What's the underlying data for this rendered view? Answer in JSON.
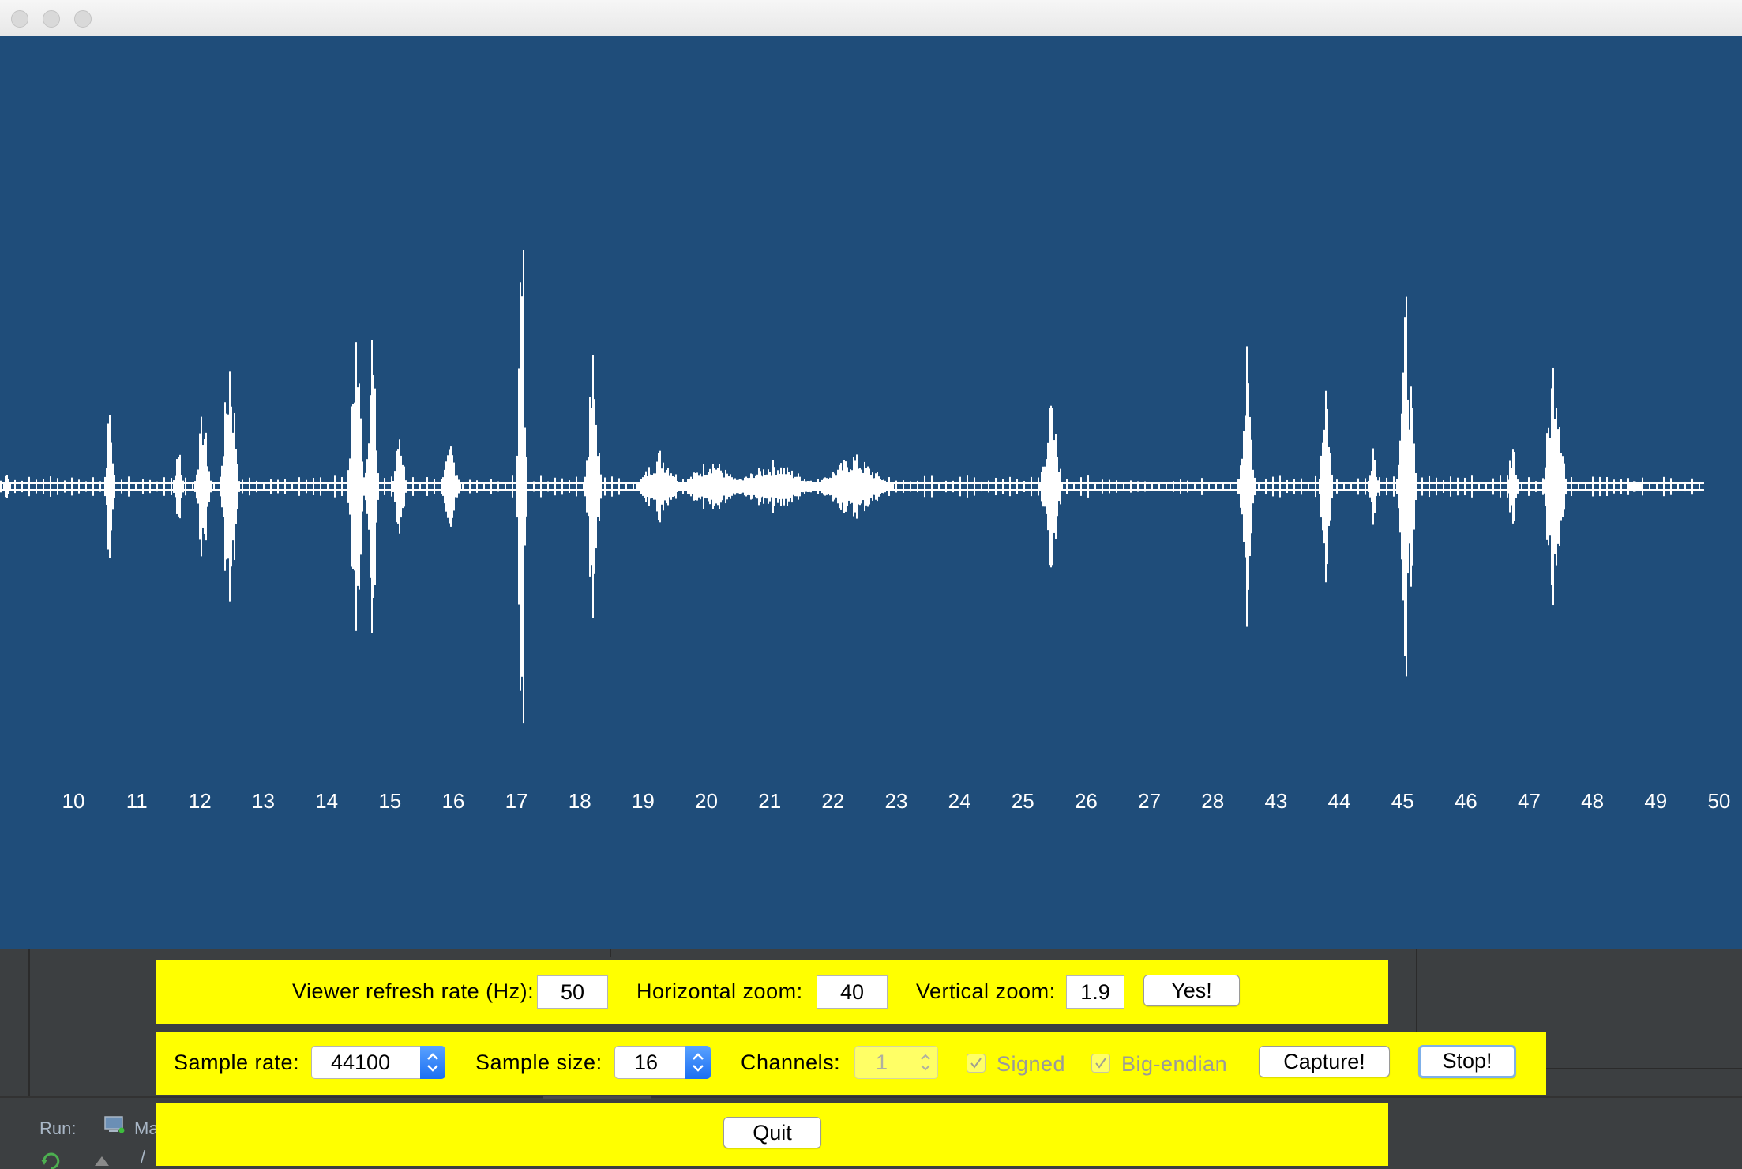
{
  "window": {
    "buttons": [
      "close-button",
      "minimize-button",
      "zoom-button"
    ]
  },
  "viewer": {
    "background": "#1f4d7a",
    "waveform_color": "#ffffff",
    "time_labels": [
      "10",
      "11",
      "12",
      "13",
      "14",
      "15",
      "16",
      "17",
      "18",
      "19",
      "20",
      "21",
      "22",
      "23",
      "24",
      "25",
      "26",
      "27",
      "28",
      "43",
      "44",
      "45",
      "46",
      "47",
      "48",
      "49",
      "50"
    ]
  },
  "controls": {
    "refresh_label": "Viewer refresh rate (Hz):",
    "refresh_value": "50",
    "hzoom_label": "Horizontal zoom:",
    "hzoom_value": "40",
    "vzoom_label": "Vertical zoom:",
    "vzoom_value": "1.9",
    "apply_button": "Yes!",
    "sample_rate_label": "Sample rate:",
    "sample_rate_value": "44100",
    "sample_size_label": "Sample size:",
    "sample_size_value": "16",
    "channels_label": "Channels:",
    "channels_value": "1",
    "signed_label": "Signed",
    "bigendian_label": "Big-endian",
    "capture_button": "Capture!",
    "stop_button": "Stop!",
    "quit_button": "Quit",
    "panel_color": "#ffff00"
  },
  "ide": {
    "run_label": "Run:",
    "run_tab": "Ma",
    "console_text": "/"
  }
}
